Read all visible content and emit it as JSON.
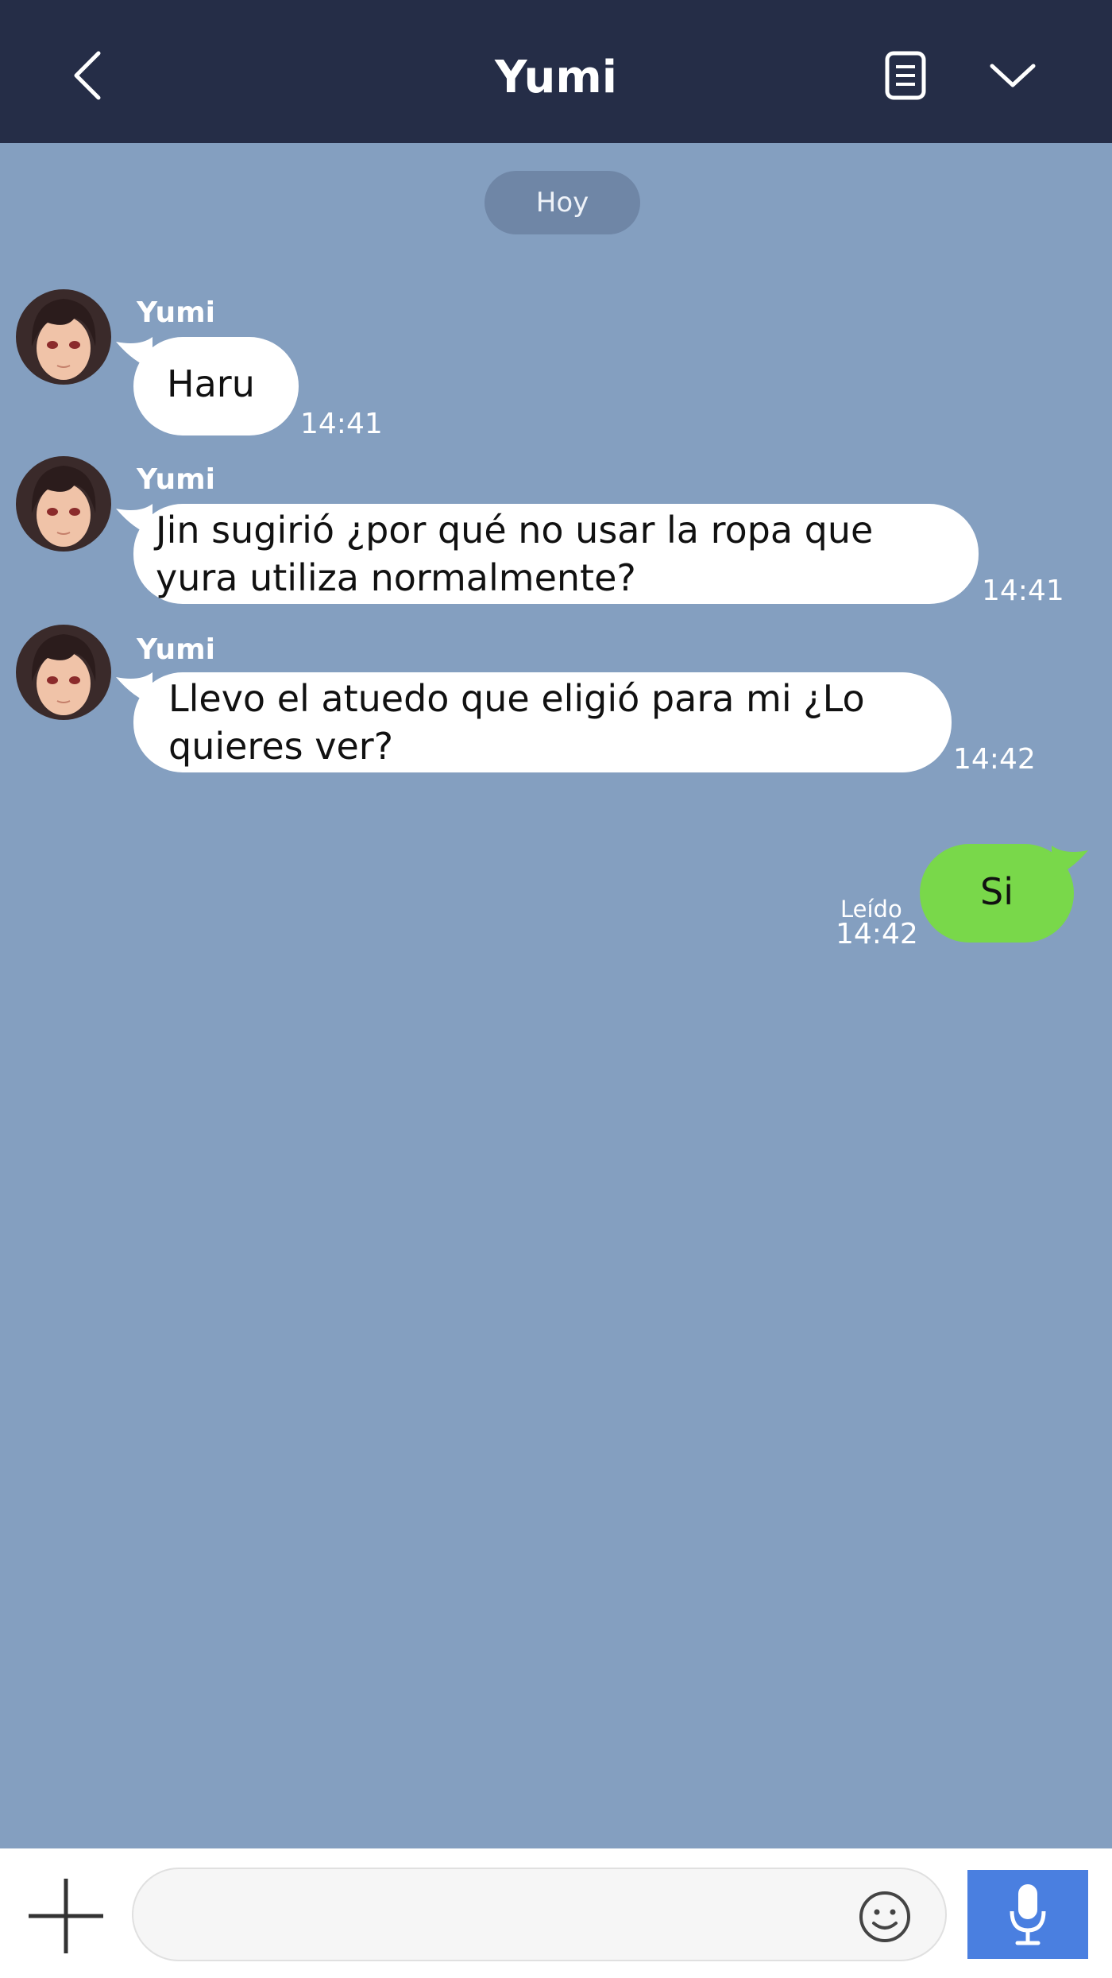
{
  "header": {
    "title": "Yumi",
    "back_icon": "chevron-left-icon",
    "notes_icon": "notes-icon",
    "menu_icon": "chevron-down-icon",
    "background": "#252d47"
  },
  "chat": {
    "background": "#849fc0",
    "date_label": "Hoy",
    "messages": [
      {
        "direction": "incoming",
        "sender": "Yumi",
        "text": "Haru",
        "time": "14:41"
      },
      {
        "direction": "incoming",
        "sender": "Yumi",
        "text": "Jin sugirió ¿por qué no usar la ropa que yura utiliza normalmente?",
        "time": "14:41"
      },
      {
        "direction": "incoming",
        "sender": "Yumi",
        "text": "Llevo el atuedo que eligió para mi ¿Lo quieres ver?",
        "time": "14:42"
      },
      {
        "direction": "outgoing",
        "text": "Si",
        "status": "Leído",
        "time": "14:42"
      }
    ],
    "incoming_bubble_color": "#ffffff",
    "outgoing_bubble_color": "#79d84a"
  },
  "composer": {
    "input_value": "",
    "input_placeholder": "",
    "add_icon": "plus-icon",
    "emoji_icon": "smiley-icon",
    "mic_icon": "microphone-icon",
    "mic_button_color": "#4a7fe0"
  }
}
